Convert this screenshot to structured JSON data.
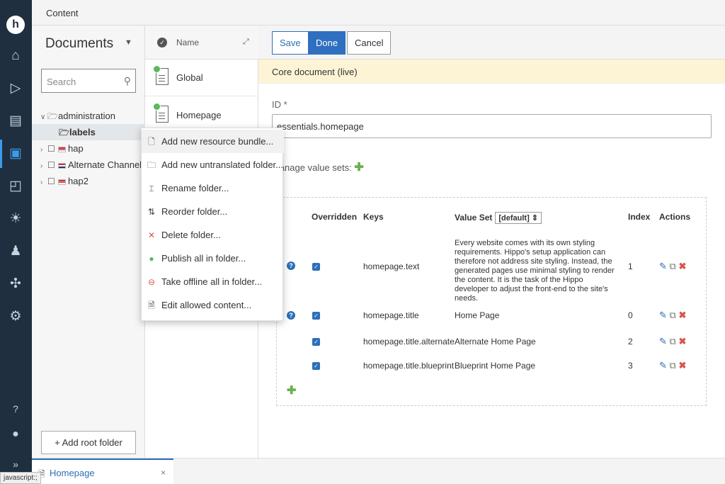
{
  "nav": {
    "logo": "h",
    "icons": [
      "home-icon",
      "play-icon",
      "clipboard-icon",
      "documents-icon",
      "reports-icon",
      "lightbulb-icon",
      "users-icon",
      "puzzle-icon",
      "gear-icon",
      "help-icon",
      "user-icon",
      "expand-icon"
    ],
    "expand": "»"
  },
  "topbar": {
    "title": "Content"
  },
  "documents": {
    "title": "Documents",
    "search_placeholder": "Search",
    "tree": [
      {
        "label": "administration",
        "expanded": true,
        "flag": ""
      },
      {
        "label": "labels",
        "selected": true,
        "flag": ""
      },
      {
        "label": "hap",
        "flag": "us"
      },
      {
        "label": "Alternate Channel",
        "flag": "nl"
      },
      {
        "label": "hap2",
        "flag": "us"
      }
    ],
    "add_root": "+ Add root folder"
  },
  "list": {
    "header": "Name",
    "items": [
      {
        "label": "Global"
      },
      {
        "label": "Homepage"
      }
    ]
  },
  "context_menu": {
    "items": [
      {
        "label": "Add new resource bundle...",
        "icon": "new-document-icon"
      },
      {
        "label": "Add new untranslated folder...",
        "icon": "new-folder-icon"
      },
      {
        "label": "Rename folder...",
        "icon": "rename-icon"
      },
      {
        "label": "Reorder folder...",
        "icon": "reorder-icon"
      },
      {
        "label": "Delete folder...",
        "icon": "delete-icon"
      },
      {
        "label": "Publish all in folder...",
        "icon": "publish-icon"
      },
      {
        "label": "Take offline all in folder...",
        "icon": "offline-icon"
      },
      {
        "label": "Edit allowed content...",
        "icon": "edit-content-icon"
      }
    ]
  },
  "editor": {
    "save": "Save",
    "done": "Done",
    "cancel": "Cancel",
    "notice": "Core document (live)",
    "id_label": "ID *",
    "id_value": "essentials.homepage",
    "manage_value_sets": "Manage value sets:",
    "table": {
      "headers": {
        "overridden": "Overridden",
        "keys": "Keys",
        "value_set": "Value Set",
        "value_set_select": "[default]",
        "index": "Index",
        "actions": "Actions"
      },
      "rows": [
        {
          "key": "homepage.text",
          "value": "Every website comes with its own styling requirements. Hippo's setup application can therefore not address site styling. Instead, the generated pages use minimal styling to render the content. It is the task of the Hippo developer to adjust the front-end to the site's needs.",
          "index": "1",
          "help": true
        },
        {
          "key": "homepage.title",
          "value": "Home Page",
          "index": "0",
          "help": true
        },
        {
          "key": "homepage.title.alternate",
          "value": "Alternate Home Page",
          "index": "2",
          "help": false
        },
        {
          "key": "homepage.title.blueprint",
          "value": "Blueprint Home Page",
          "index": "3",
          "help": false
        }
      ]
    }
  },
  "bottom": {
    "tab_label": "Homepage",
    "close": "×"
  },
  "status": "javascript:;"
}
